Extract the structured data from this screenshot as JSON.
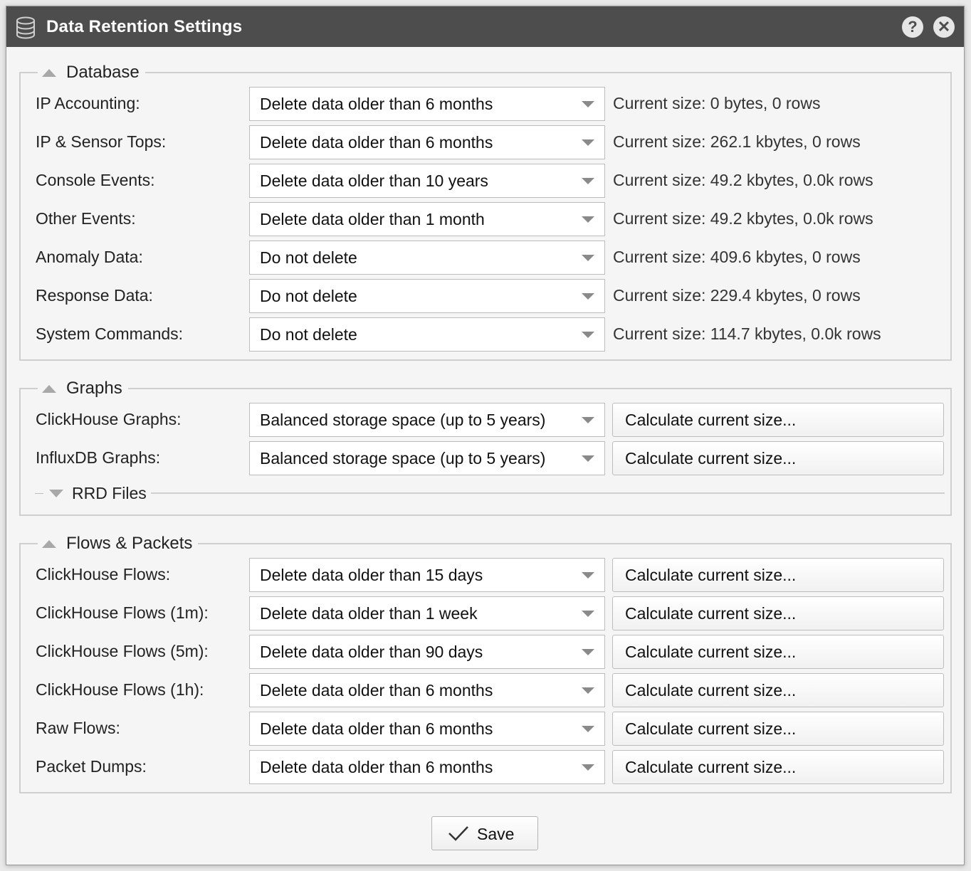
{
  "window": {
    "title": "Data Retention Settings",
    "help_icon": "help-icon",
    "close_icon": "close-icon"
  },
  "database": {
    "legend": "Database",
    "rows": [
      {
        "label": "IP Accounting:",
        "value": "Delete data older than 6 months",
        "size": "Current size: 0 bytes, 0 rows"
      },
      {
        "label": "IP & Sensor Tops:",
        "value": "Delete data older than 6 months",
        "size": "Current size: 262.1 kbytes, 0 rows"
      },
      {
        "label": "Console Events:",
        "value": "Delete data older than 10 years",
        "size": "Current size: 49.2 kbytes, 0.0k rows"
      },
      {
        "label": "Other Events:",
        "value": "Delete data older than 1 month",
        "size": "Current size: 49.2 kbytes, 0.0k rows"
      },
      {
        "label": "Anomaly Data:",
        "value": "Do not delete",
        "size": "Current size: 409.6 kbytes, 0 rows"
      },
      {
        "label": "Response Data:",
        "value": "Do not delete",
        "size": "Current size: 229.4 kbytes, 0 rows"
      },
      {
        "label": "System Commands:",
        "value": "Do not delete",
        "size": "Current size: 114.7 kbytes, 0.0k rows"
      }
    ]
  },
  "graphs": {
    "legend": "Graphs",
    "rows": [
      {
        "label": "ClickHouse Graphs:",
        "value": "Balanced storage space (up to 5 years)",
        "button": "Calculate current size..."
      },
      {
        "label": "InfluxDB Graphs:",
        "value": "Balanced storage space (up to 5 years)",
        "button": "Calculate current size..."
      }
    ],
    "rrd_label": "RRD Files"
  },
  "flows": {
    "legend": "Flows & Packets",
    "rows": [
      {
        "label": "ClickHouse Flows:",
        "value": "Delete data older than 15 days",
        "button": "Calculate current size..."
      },
      {
        "label": "ClickHouse Flows (1m):",
        "value": "Delete data older than 1 week",
        "button": "Calculate current size..."
      },
      {
        "label": "ClickHouse Flows (5m):",
        "value": "Delete data older than 90 days",
        "button": "Calculate current size..."
      },
      {
        "label": "ClickHouse Flows (1h):",
        "value": "Delete data older than 6 months",
        "button": "Calculate current size..."
      },
      {
        "label": "Raw Flows:",
        "value": "Delete data older than 6 months",
        "button": "Calculate current size..."
      },
      {
        "label": "Packet Dumps:",
        "value": "Delete data older than 6 months",
        "button": "Calculate current size..."
      }
    ]
  },
  "footer": {
    "save_label": "Save"
  },
  "colors": {
    "titlebar": "#4d4d4d",
    "border": "#cfcfcf",
    "background": "#f5f5f5"
  }
}
